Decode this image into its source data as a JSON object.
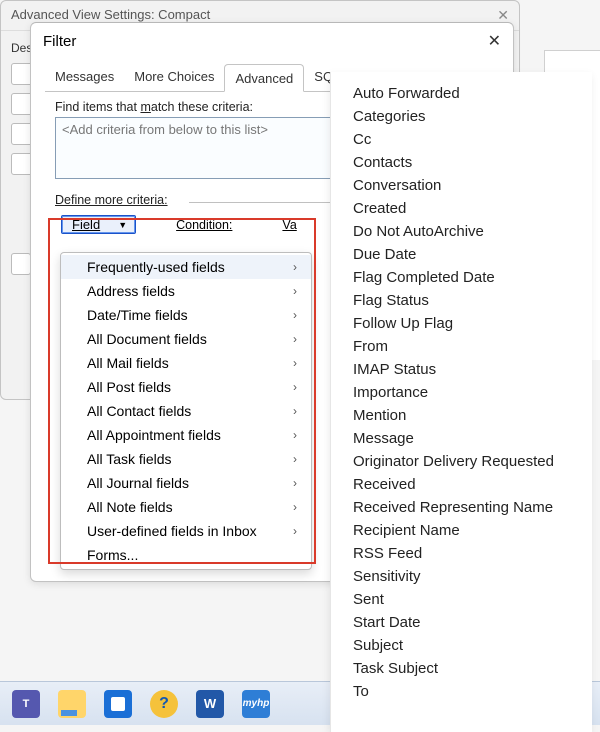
{
  "parent_dialog": {
    "title": "Advanced View Settings: Compact",
    "desc_prefix": "Des"
  },
  "filter_dialog": {
    "title": "Filter",
    "tabs": [
      "Messages",
      "More Choices",
      "Advanced",
      "SQL"
    ],
    "active_tab_index": 2,
    "criteria_label_pre": "Find items that ",
    "criteria_label_u": "m",
    "criteria_label_post": "atch these criteria:",
    "criteria_placeholder": "<Add criteria from below to this list>",
    "define_label": "Define more criteria:",
    "field_button": "Field",
    "condition_label": "Condition:",
    "value_label": "Va"
  },
  "field_menu": [
    {
      "label": "Frequently-used fields",
      "has_sub": true,
      "highlight": true
    },
    {
      "label": "Address fields",
      "has_sub": true
    },
    {
      "label": "Date/Time fields",
      "has_sub": true
    },
    {
      "label": "All Document fields",
      "has_sub": true
    },
    {
      "label": "All Mail fields",
      "has_sub": true
    },
    {
      "label": "All Post fields",
      "has_sub": true
    },
    {
      "label": "All Contact fields",
      "has_sub": true
    },
    {
      "label": "All Appointment fields",
      "has_sub": true
    },
    {
      "label": "All Task fields",
      "has_sub": true
    },
    {
      "label": "All Journal fields",
      "has_sub": true
    },
    {
      "label": "All Note fields",
      "has_sub": true
    },
    {
      "label": "User-defined fields in Inbox",
      "has_sub": true
    },
    {
      "label": "Forms...",
      "has_sub": false
    }
  ],
  "submenu": [
    "Auto Forwarded",
    "Categories",
    "Cc",
    "Contacts",
    "Conversation",
    "Created",
    "Do Not AutoArchive",
    "Due Date",
    "Flag Completed Date",
    "Flag Status",
    "Follow Up Flag",
    "From",
    "IMAP Status",
    "Importance",
    "Mention",
    "Message",
    "Originator Delivery Requested",
    "Received",
    "Received Representing Name",
    "Recipient Name",
    "RSS Feed",
    "Sensitivity",
    "Sent",
    "Start Date",
    "Subject",
    "Task Subject",
    "To"
  ],
  "taskbar": {
    "teams": "T",
    "word": "W",
    "myhp": "myhp"
  }
}
